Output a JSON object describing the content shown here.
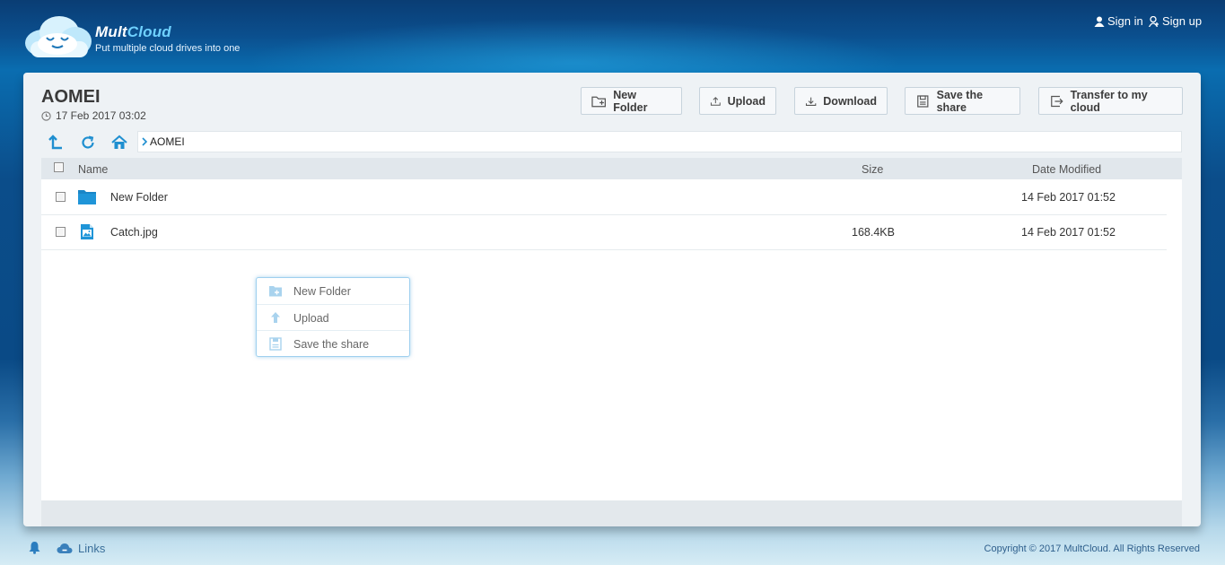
{
  "header": {
    "brand_part1": "Mult",
    "brand_part2": "Cloud",
    "tagline": "Put multiple cloud drives into one",
    "sign_in": "Sign in",
    "sign_up": "Sign up"
  },
  "folder": {
    "title": "AOMEI",
    "date": "17 Feb 2017 03:02"
  },
  "toolbar": {
    "new_folder": "New Folder",
    "upload": "Upload",
    "download": "Download",
    "save_share": "Save the share",
    "transfer": "Transfer to my cloud"
  },
  "path": {
    "current": "AOMEI"
  },
  "columns": {
    "name": "Name",
    "size": "Size",
    "date": "Date Modified"
  },
  "files": [
    {
      "name": "New Folder",
      "size": "",
      "date": "14 Feb 2017 01:52",
      "type": "folder-icon"
    },
    {
      "name": "Catch.jpg",
      "size": "168.4KB",
      "date": "14 Feb 2017 01:52",
      "type": "image-file-icon"
    }
  ],
  "context_menu": {
    "items": [
      {
        "label": "New Folder",
        "icon": "new-folder-icon"
      },
      {
        "label": "Upload",
        "icon": "upload-arrow-icon"
      },
      {
        "label": "Save the share",
        "icon": "save-icon"
      }
    ]
  },
  "footer": {
    "links": "Links",
    "copyright": "Copyright © 2017 MultCloud. All Rights Reserved"
  },
  "colors": {
    "accent": "#1f8fd0",
    "header_bg": "#0b4f8e",
    "panel_bg": "#eef2f5"
  }
}
